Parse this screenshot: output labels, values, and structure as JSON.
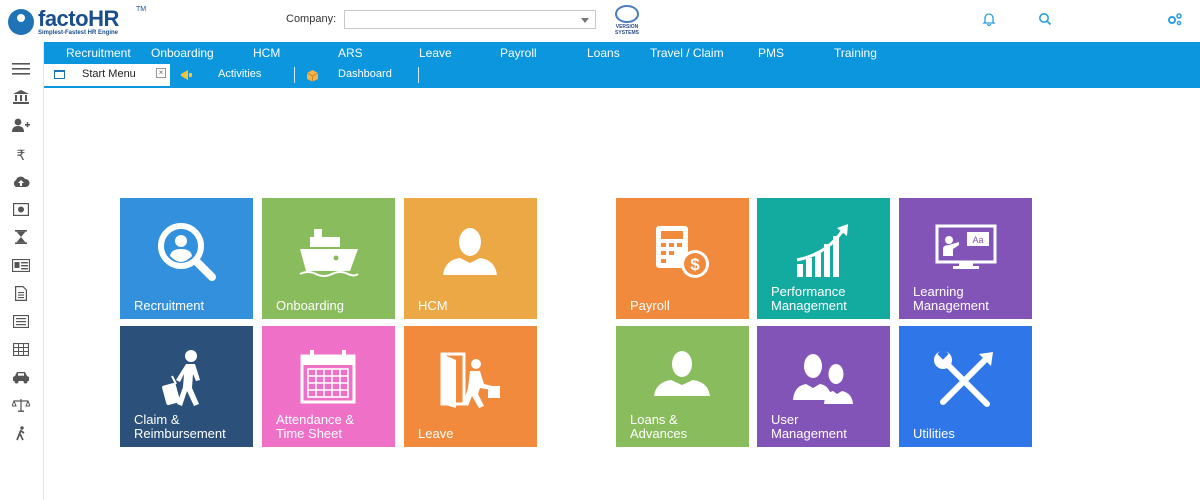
{
  "header": {
    "logo": {
      "brand": "facto",
      "brand_accent": "HR",
      "trademark": "TM",
      "tagline": "Simplest-Fastest HR Engine"
    },
    "company_label": "Company:",
    "company_value": "",
    "version_logo": {
      "line1": "VERSION",
      "line2": "SYSTEMS"
    },
    "icons": [
      "bell-icon",
      "search-icon",
      "settings-icon"
    ]
  },
  "main_nav": [
    "Recruitment",
    "Onboarding",
    "HCM",
    "ARS",
    "Leave",
    "Payroll",
    "Loans",
    "Travel / Claim",
    "PMS",
    "Training"
  ],
  "tabs": {
    "active": {
      "label": "Start Menu",
      "close": "×"
    },
    "items": [
      {
        "label": "Activities",
        "icon": "megaphone-icon"
      },
      {
        "label": "Dashboard",
        "icon": "cube-icon"
      }
    ]
  },
  "sidebar": {
    "icons": [
      "menu-icon",
      "bank-icon",
      "add-user-icon",
      "rupee-icon",
      "cloud-upload-icon",
      "money-icon",
      "hourglass-icon",
      "id-card-icon",
      "document-icon",
      "list-icon",
      "table-icon",
      "car-icon",
      "balance-scale-icon",
      "walking-icon"
    ]
  },
  "tiles": [
    {
      "id": "recruitment",
      "label": [
        "Recruitment"
      ],
      "color": "#3390dd",
      "icon": "search-user-icon"
    },
    {
      "id": "onboarding",
      "label": [
        "Onboarding"
      ],
      "color": "#89bc5d",
      "icon": "ship-icon"
    },
    {
      "id": "hcm",
      "label": [
        "HCM"
      ],
      "color": "#eba844",
      "icon": "person-icon"
    },
    {
      "id": "payroll",
      "label": [
        "Payroll"
      ],
      "color": "#f18a3d",
      "icon": "calculator-dollar-icon"
    },
    {
      "id": "performance",
      "label": [
        "Performance",
        "Management"
      ],
      "color": "#13ab9f",
      "icon": "growth-chart-icon"
    },
    {
      "id": "learning",
      "label": [
        "Learning",
        "Management"
      ],
      "color": "#8354b8",
      "icon": "presentation-icon"
    },
    {
      "id": "claim",
      "label": [
        "Claim &",
        "Reimbursement"
      ],
      "color": "#2b5079",
      "icon": "traveler-icon"
    },
    {
      "id": "attendance",
      "label": [
        "Attendance &",
        "Time Sheet"
      ],
      "color": "#ee70c7",
      "icon": "calendar-icon"
    },
    {
      "id": "leave",
      "label": [
        "Leave"
      ],
      "color": "#f18a3d",
      "icon": "exit-door-icon"
    },
    {
      "id": "loans",
      "label": [
        "Loans &",
        "Advances"
      ],
      "color": "#89bc5d",
      "icon": "person-icon"
    },
    {
      "id": "user",
      "label": [
        "User",
        "Management"
      ],
      "color": "#8354b8",
      "icon": "users-icon"
    },
    {
      "id": "utilities",
      "label": [
        "Utilities"
      ],
      "color": "#2f76e8",
      "icon": "tools-icon"
    }
  ]
}
